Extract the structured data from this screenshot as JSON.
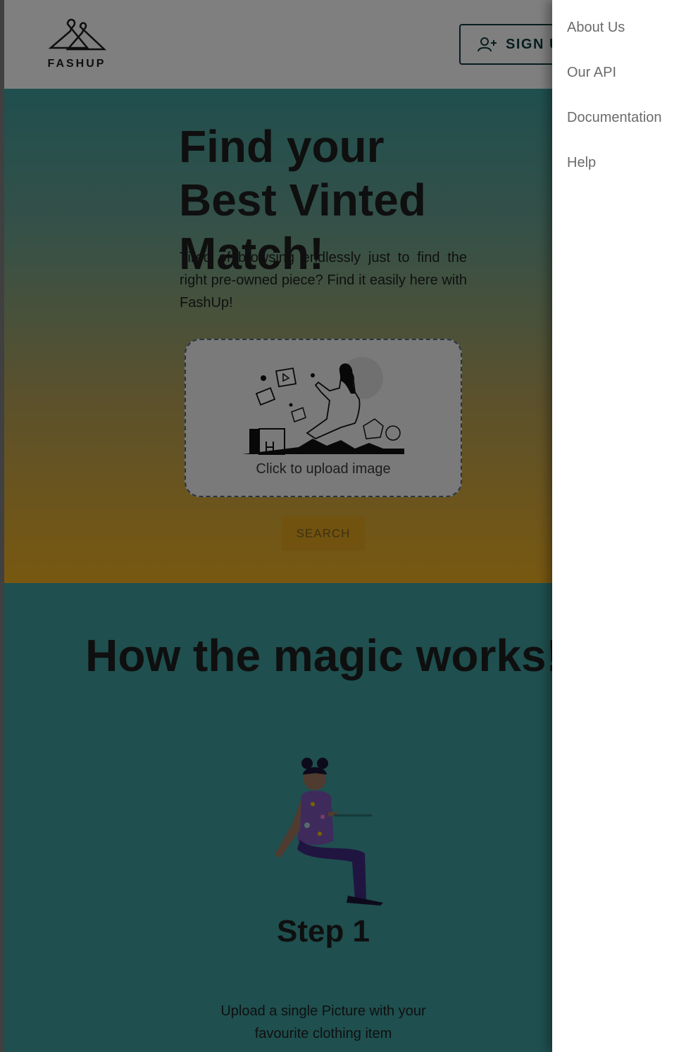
{
  "header": {
    "logo_text": "FASHUP",
    "signup_label": "SIGN UP"
  },
  "hero": {
    "title": "Find your Best Vinted Match!",
    "description": "Tired of browsing endlessly just to find the right pre-owned piece? Find it easily here with FashUp!",
    "upload_label": "Click to upload image",
    "search_label": "SEARCH"
  },
  "how_it_works": {
    "title": "How the magic works!",
    "step_title": "Step 1",
    "step_description": "Upload a single Picture with your favourite clothing item"
  },
  "drawer": {
    "items": [
      {
        "label": "About Us"
      },
      {
        "label": "Our API"
      },
      {
        "label": "Documentation"
      },
      {
        "label": "Help"
      }
    ]
  },
  "colors": {
    "hero_top": "#3f9e9e",
    "hero_bottom": "#f1b121",
    "section_bg": "#3f9e9e",
    "button_outline": "#0f3b3c",
    "search_button": "#e3a51e",
    "drawer_text": "#6b6b6b"
  },
  "icons": [
    "hanger-logo-icon",
    "add-user-icon",
    "upload-illustration",
    "person-with-laptop-illustration"
  ]
}
